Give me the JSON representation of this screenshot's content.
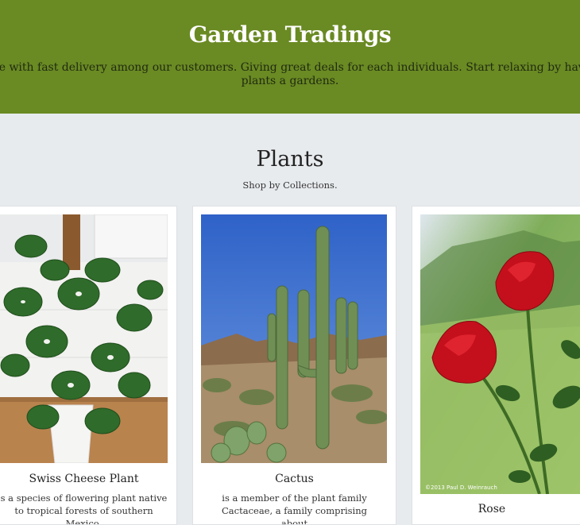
{
  "header": {
    "title": "Garden Tradings",
    "tagline": "rvice with fast delivery among our customers. Giving great deals for each individuals. Start relaxing by having plants a gardens."
  },
  "section": {
    "title": "Plants",
    "subtitle": "Shop by Collections."
  },
  "cards": [
    {
      "name": "Swiss Cheese Plant",
      "description": "s a species of flowering plant native to tropical forests of southern Mexico,"
    },
    {
      "name": "Cactus",
      "description": "is a member of the plant family Cactaceae, a family comprising about"
    },
    {
      "name": "Rose",
      "description": ""
    }
  ],
  "photo_credit": "©2013 Paul D. Weinrauch",
  "colors": {
    "header_bg": "#6a8a23",
    "page_bg": "#e8ebee",
    "card_bg": "#ffffff"
  }
}
